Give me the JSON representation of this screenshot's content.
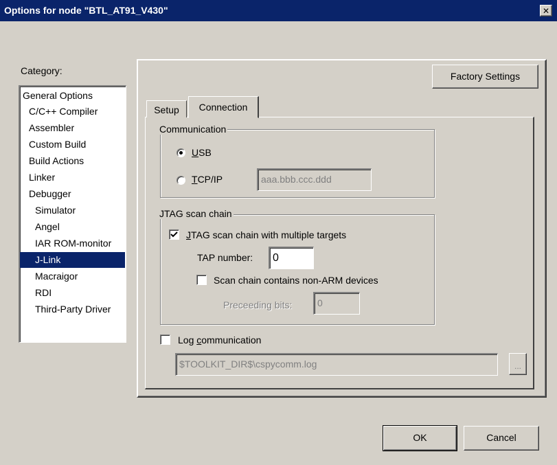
{
  "window": {
    "title": "Options for node \"BTL_AT91_V430\"",
    "close_glyph": "✕"
  },
  "category": {
    "label": "Category:",
    "items": [
      {
        "label": "General Options"
      },
      {
        "label": "C/C++ Compiler"
      },
      {
        "label": "Assembler"
      },
      {
        "label": "Custom Build"
      },
      {
        "label": "Build Actions"
      },
      {
        "label": "Linker"
      },
      {
        "label": "Debugger"
      },
      {
        "label": "Simulator"
      },
      {
        "label": "Angel"
      },
      {
        "label": "IAR ROM-monitor"
      },
      {
        "label": "J-Link"
      },
      {
        "label": "Macraigor"
      },
      {
        "label": "RDI"
      },
      {
        "label": "Third-Party Driver"
      }
    ],
    "selected": "J-Link"
  },
  "factory_settings_label": "Factory Settings",
  "tabs": [
    {
      "label": "Setup",
      "active": false
    },
    {
      "label": "Connection",
      "active": true
    }
  ],
  "communication": {
    "title": "Communication",
    "usb": {
      "prefix": "",
      "mnemonic": "U",
      "suffix": "SB",
      "selected": true
    },
    "tcpip": {
      "prefix": "",
      "mnemonic": "T",
      "suffix": "CP/IP",
      "selected": false
    },
    "ip_address": "aaa.bbb.ccc.ddd"
  },
  "jtag": {
    "title": "JTAG scan chain",
    "multiple_targets": {
      "prefix": "",
      "mnemonic": "J",
      "suffix": "TAG scan chain with multiple targets",
      "checked": true
    },
    "tap_number_label": "TAP number:",
    "tap_number_value": "0",
    "non_arm": {
      "label": "Scan chain contains non-ARM devices",
      "checked": false
    },
    "preceeding_bits_label": "Preceeding bits:",
    "preceeding_bits_value": "0"
  },
  "log": {
    "prefix": "Log ",
    "mnemonic": "c",
    "suffix": "ommunication",
    "checked": false,
    "path": "$TOOLKIT_DIR$\\cspycomm.log",
    "browse_label": "..."
  },
  "buttons": {
    "ok": "OK",
    "cancel": "Cancel"
  },
  "colors": {
    "titlebar": "#0a246a",
    "face": "#d4d0c8",
    "selection": "#0a246a"
  }
}
